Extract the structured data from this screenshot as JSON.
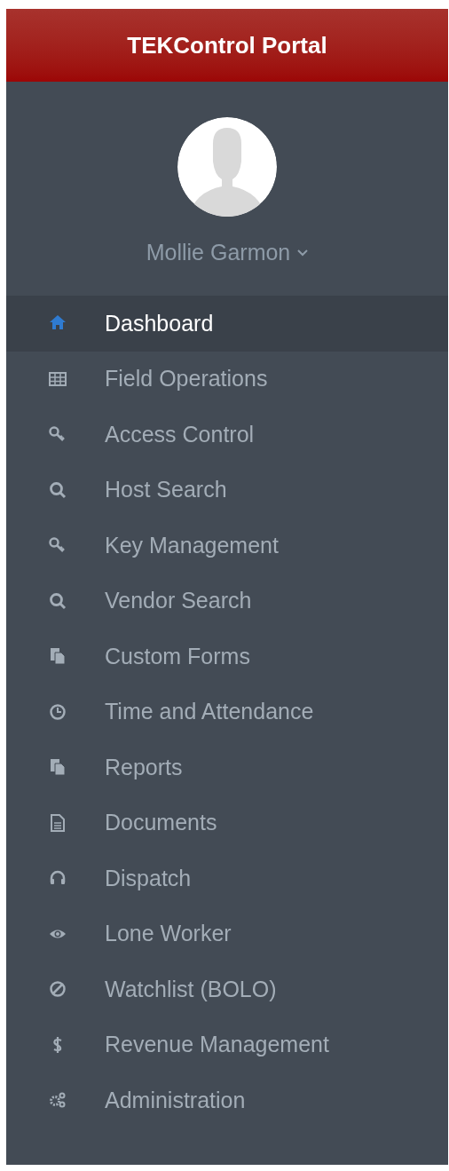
{
  "header": {
    "title": "TEKControl Portal"
  },
  "user": {
    "name": "Mollie Garmon"
  },
  "menu": [
    {
      "label": "Dashboard",
      "selected": true
    },
    {
      "label": "Field Operations",
      "selected": false
    },
    {
      "label": "Access Control",
      "selected": false
    },
    {
      "label": "Host Search",
      "selected": false
    },
    {
      "label": "Key Management",
      "selected": false
    },
    {
      "label": "Vendor Search",
      "selected": false
    },
    {
      "label": "Custom Forms",
      "selected": false
    },
    {
      "label": "Time and Attendance",
      "selected": false
    },
    {
      "label": "Reports",
      "selected": false
    },
    {
      "label": "Documents",
      "selected": false
    },
    {
      "label": "Dispatch",
      "selected": false
    },
    {
      "label": "Lone Worker",
      "selected": false
    },
    {
      "label": "Watchlist (BOLO)",
      "selected": false
    },
    {
      "label": "Revenue Management",
      "selected": false
    },
    {
      "label": "Administration",
      "selected": false
    }
  ]
}
